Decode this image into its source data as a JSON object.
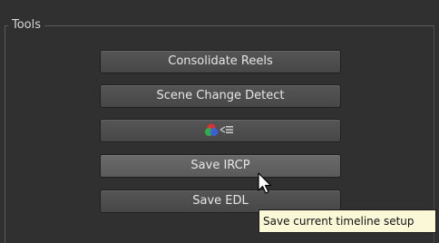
{
  "group": {
    "title": "Tools"
  },
  "buttons": [
    {
      "label": "Consolidate Reels"
    },
    {
      "label": "Scene Change Detect"
    },
    {
      "label": "",
      "icon": "color-graph-icon"
    },
    {
      "label": "Save IRCP"
    },
    {
      "label": "Save EDL"
    }
  ],
  "tooltip": {
    "text": "Save current timeline setup"
  },
  "colors": {
    "panel_bg": "#303030",
    "button_bg": "#4e4e4e",
    "button_hover_bg": "#626262",
    "tooltip_bg": "#fbf8d8"
  }
}
